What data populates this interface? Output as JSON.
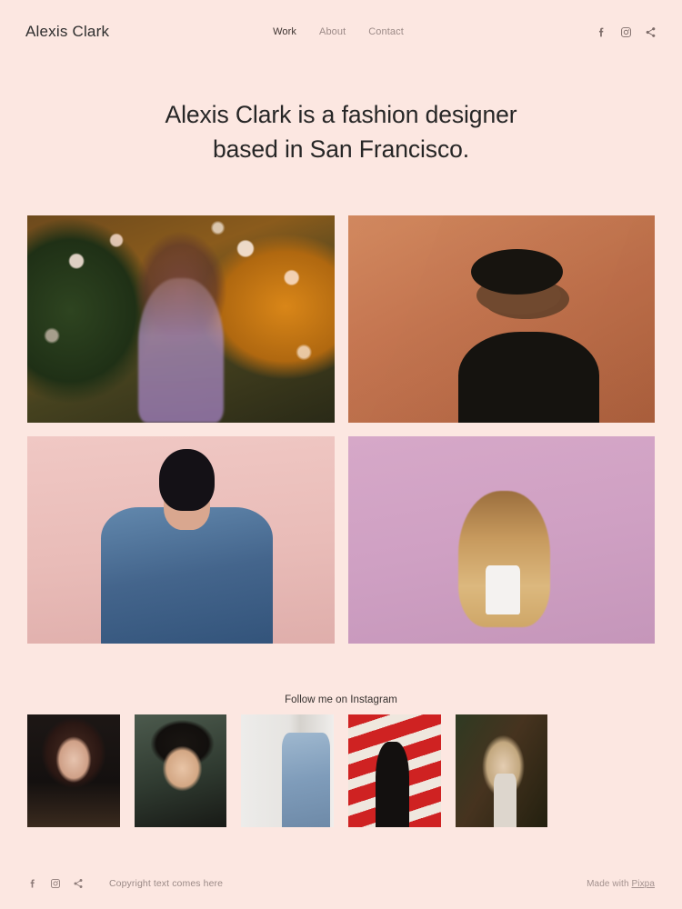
{
  "site": {
    "background_color": "#fce7e1",
    "logo": "Alexis Clark"
  },
  "header": {
    "nav": [
      {
        "label": "Work",
        "active": true
      },
      {
        "label": "About",
        "active": false
      },
      {
        "label": "Contact",
        "active": false
      }
    ],
    "social": [
      {
        "name": "facebook-icon",
        "label": "Facebook"
      },
      {
        "name": "instagram-icon",
        "label": "Instagram"
      },
      {
        "name": "share-icon",
        "label": "Share"
      }
    ]
  },
  "hero": {
    "title_line_1": "Alexis Clark is a fashion designer",
    "title_line_2": "based in San Francisco.",
    "text_color": "#262626"
  },
  "gallery": {
    "items": [
      {
        "alt": "Woman with curly hair among autumn blossoms",
        "art": "art-blossom"
      },
      {
        "alt": "Man in black hat and sunglasses against terracotta wall",
        "art": "art-terracotta"
      },
      {
        "alt": "Woman in denim jacket against pink wall",
        "art": "art-denim"
      },
      {
        "alt": "Blonde woman with long wavy hair on lavender background",
        "art": "art-lavender"
      }
    ]
  },
  "instagram": {
    "heading": "Follow me on Instagram",
    "items": [
      {
        "alt": "Dark moody portrait of woman",
        "art": "ig-dark-portrait"
      },
      {
        "alt": "Portrait of young man with dark hair",
        "art": "ig-teen-portrait"
      },
      {
        "alt": "Man in denim jacket in bright hallway",
        "art": "ig-denim-hall"
      },
      {
        "alt": "Silhouette against red and white stripes",
        "art": "ig-red-stripes"
      },
      {
        "alt": "Blonde woman in forest setting",
        "art": "ig-forest-blonde"
      }
    ]
  },
  "footer": {
    "social": [
      {
        "name": "facebook-icon",
        "label": "Facebook"
      },
      {
        "name": "instagram-icon",
        "label": "Instagram"
      },
      {
        "name": "share-icon",
        "label": "Share"
      }
    ],
    "copyright": "Copyright text comes here",
    "made_with_prefix": "Made with ",
    "made_with_brand": "Pixpa"
  }
}
